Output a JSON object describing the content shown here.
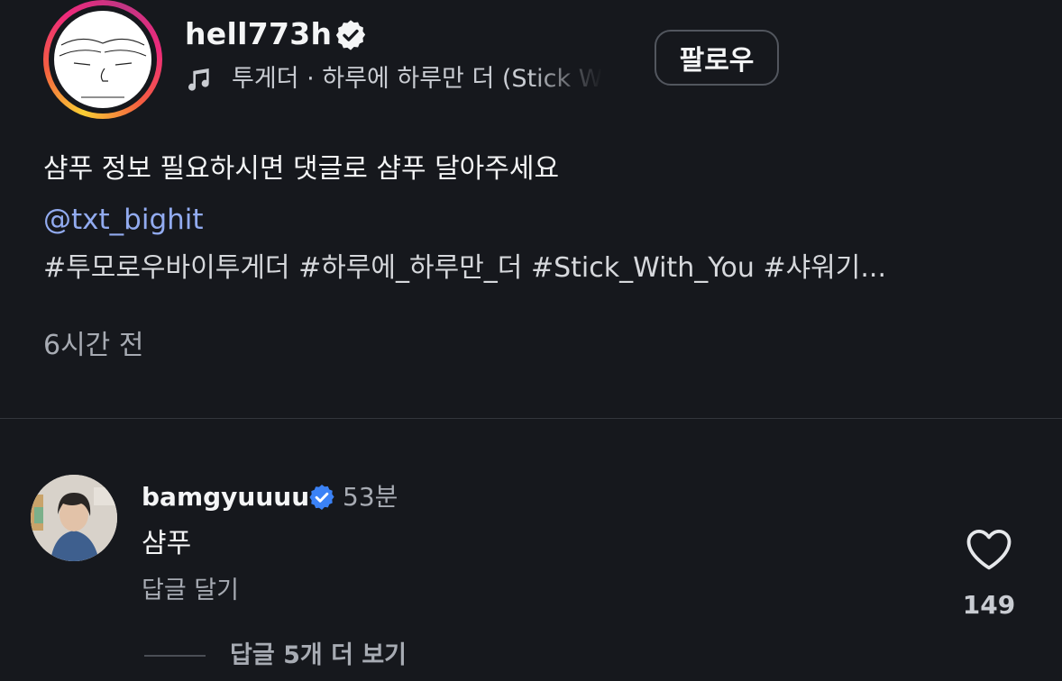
{
  "post": {
    "username": "hell773h",
    "music": {
      "icon": "music-note-icon",
      "text": "투게더 · 하루에 하루만 더 (Stick W"
    },
    "follow_label": "팔로우",
    "caption": "샴푸 정보 필요하시면 댓글로 샴푸 달아주세요",
    "mention": "@txt_bighit",
    "hashtags": "#투모로우바이투게더 #하루에_하루만_더 #Stick_With_You #샤워기...",
    "time_ago": "6시간 전"
  },
  "comment": {
    "username": "bamgyuuuu",
    "time": "53분",
    "text": "샴푸",
    "reply_label": "답글 달기",
    "like_count": "149",
    "view_replies_label": "답글 5개 더 보기"
  },
  "colors": {
    "background": "#16181d",
    "mention": "#92abf0",
    "verified_blue": "#3b82f6",
    "story_ring": [
      "#f9ce34",
      "#ee2a7b",
      "#c13584"
    ]
  }
}
